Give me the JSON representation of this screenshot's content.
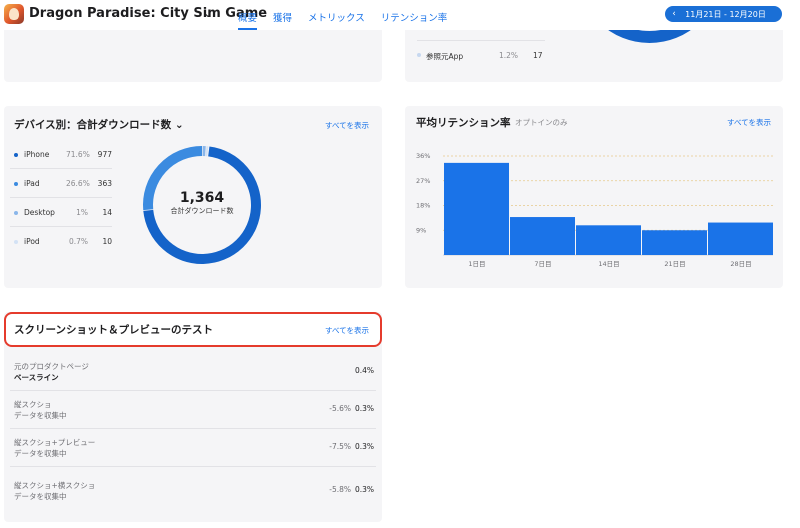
{
  "header": {
    "app_title": "Dragon Paradise: City Sim Game",
    "tabs": [
      "概要",
      "獲得",
      "メトリックス",
      "リテンション率"
    ],
    "date_range": "11月21日 - 12月20日"
  },
  "top_right": {
    "referrer_label": "参照元App",
    "referrer_pct": "1.2%",
    "referrer_value": "17"
  },
  "devices": {
    "title": "デバイス別：合計ダウンロード数",
    "see_all": "すべてを表示",
    "total": "1,364",
    "total_caption": "合計ダウンロード数",
    "rows": [
      {
        "label": "iPhone",
        "pct": "71.6%",
        "value": "977",
        "share": 0.716,
        "color": "#1463c9"
      },
      {
        "label": "iPad",
        "pct": "26.6%",
        "value": "363",
        "share": 0.266,
        "color": "#3b8be0"
      },
      {
        "label": "Desktop",
        "pct": "1%",
        "value": "14",
        "share": 0.01,
        "color": "#8ab6ea"
      },
      {
        "label": "iPod",
        "pct": "0.7%",
        "value": "10",
        "share": 0.007,
        "color": "#d3e2f5"
      }
    ]
  },
  "retention": {
    "title": "平均リテンション率",
    "subtitle": "オプトインのみ",
    "see_all": "すべてを表示"
  },
  "chart_data": {
    "type": "bar",
    "categories": [
      "1日目",
      "7日目",
      "14日目",
      "21日目",
      "28日目"
    ],
    "values": [
      33.5,
      13.8,
      10.8,
      9,
      11.8
    ],
    "yticks": [
      "36%",
      "27%",
      "18%",
      "9%"
    ],
    "ytick_values": [
      36,
      27,
      18,
      9
    ],
    "ylim": [
      0,
      36
    ],
    "color": "#1a73e8",
    "grid": true
  },
  "test": {
    "title": "スクリーンショット＆プレビューのテスト",
    "see_all": "すべてを表示",
    "rows": [
      {
        "line1": "元のプロダクトページ",
        "line2": "ベースライン",
        "improvement": "",
        "conversion": "0.4%"
      },
      {
        "line1": "縦スクショ",
        "line2": "データを収集中",
        "improvement": "-5.6%",
        "conversion": "0.3%"
      },
      {
        "line1": "縦スクショ+プレビュー",
        "line2": "データを収集中",
        "improvement": "-7.5%",
        "conversion": "0.3%"
      },
      {
        "line1": "縦スクショ+横スクショ",
        "line2": "データを収集中",
        "improvement": "-5.8%",
        "conversion": "0.3%"
      }
    ]
  }
}
